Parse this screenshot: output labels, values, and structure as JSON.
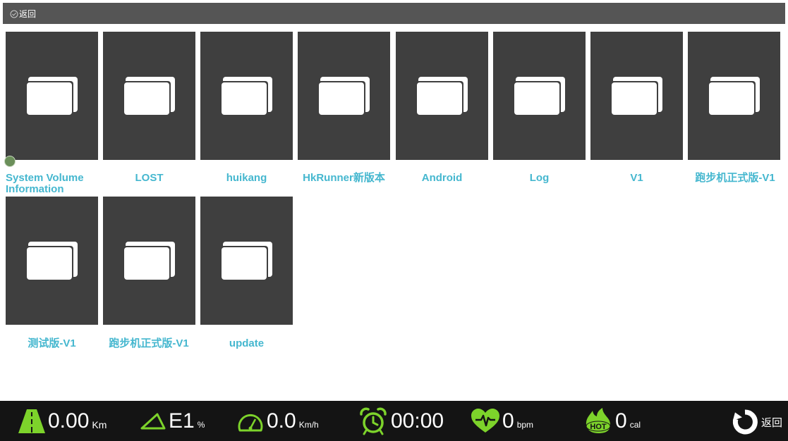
{
  "top_bar": {
    "back_label": "返回"
  },
  "folders": [
    {
      "name": "System Volume Information"
    },
    {
      "name": "LOST"
    },
    {
      "name": "huikang"
    },
    {
      "name": "HkRunner新版本"
    },
    {
      "name": "Android"
    },
    {
      "name": "Log"
    },
    {
      "name": "V1"
    },
    {
      "name": "跑步机正式版-V1"
    },
    {
      "name": "测试版-V1"
    },
    {
      "name": "跑步机正式版-V1"
    },
    {
      "name": "update"
    }
  ],
  "status_bar": {
    "distance": {
      "value": "0.00",
      "unit": "Km"
    },
    "incline": {
      "value": "E1",
      "unit": "%"
    },
    "speed": {
      "value": "0.0",
      "unit": "Km/h"
    },
    "time": {
      "value": "00:00"
    },
    "heart_rate": {
      "value": "0",
      "unit": "bpm"
    },
    "calories": {
      "value": "0",
      "unit": "cal",
      "icon_text": "HOT"
    },
    "back_label": "返回"
  },
  "colors": {
    "label": "#45b7cf",
    "tile": "#3f3f3f",
    "accent_green": "#7dd32b",
    "top_bar": "#555555",
    "bottom_bar": "#141414"
  }
}
